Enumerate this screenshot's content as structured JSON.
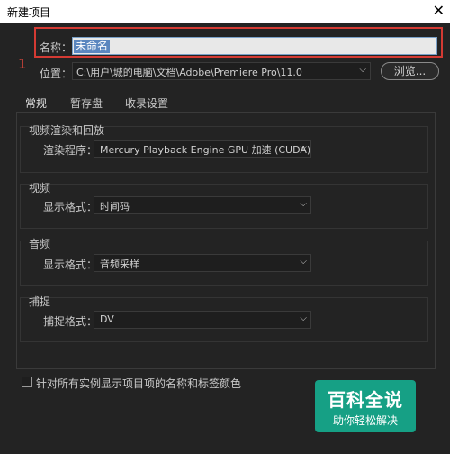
{
  "window": {
    "title": "新建项目",
    "close_glyph": "✕"
  },
  "annotation": {
    "step": "1"
  },
  "name": {
    "label": "名称：",
    "value": "未命名"
  },
  "location": {
    "label": "位置：",
    "value": "C:\\用户\\城的电脑\\文档\\Adobe\\Premiere Pro\\11.0",
    "browse_label": "浏览..."
  },
  "tabs": [
    "常规",
    "暂存盘",
    "收录设置"
  ],
  "groups": {
    "video_render": {
      "title": "视频渲染和回放",
      "label": "渲染程序：",
      "value": "Mercury Playback Engine GPU 加速 (CUDA)"
    },
    "video": {
      "title": "视频",
      "label": "显示格式：",
      "value": "时间码"
    },
    "audio": {
      "title": "音频",
      "label": "显示格式：",
      "value": "音频采样"
    },
    "capture": {
      "title": "捕捉",
      "label": "捕捉格式：",
      "value": "DV"
    }
  },
  "checkbox": {
    "label": "针对所有实例显示项目项的名称和标签颜色",
    "checked": false
  },
  "watermark": {
    "line1": "百科全说",
    "line2": "助你轻松解决"
  },
  "icons": {
    "close": "close-icon",
    "chevron": "chevron-down-icon",
    "checkbox": "checkbox-icon"
  }
}
